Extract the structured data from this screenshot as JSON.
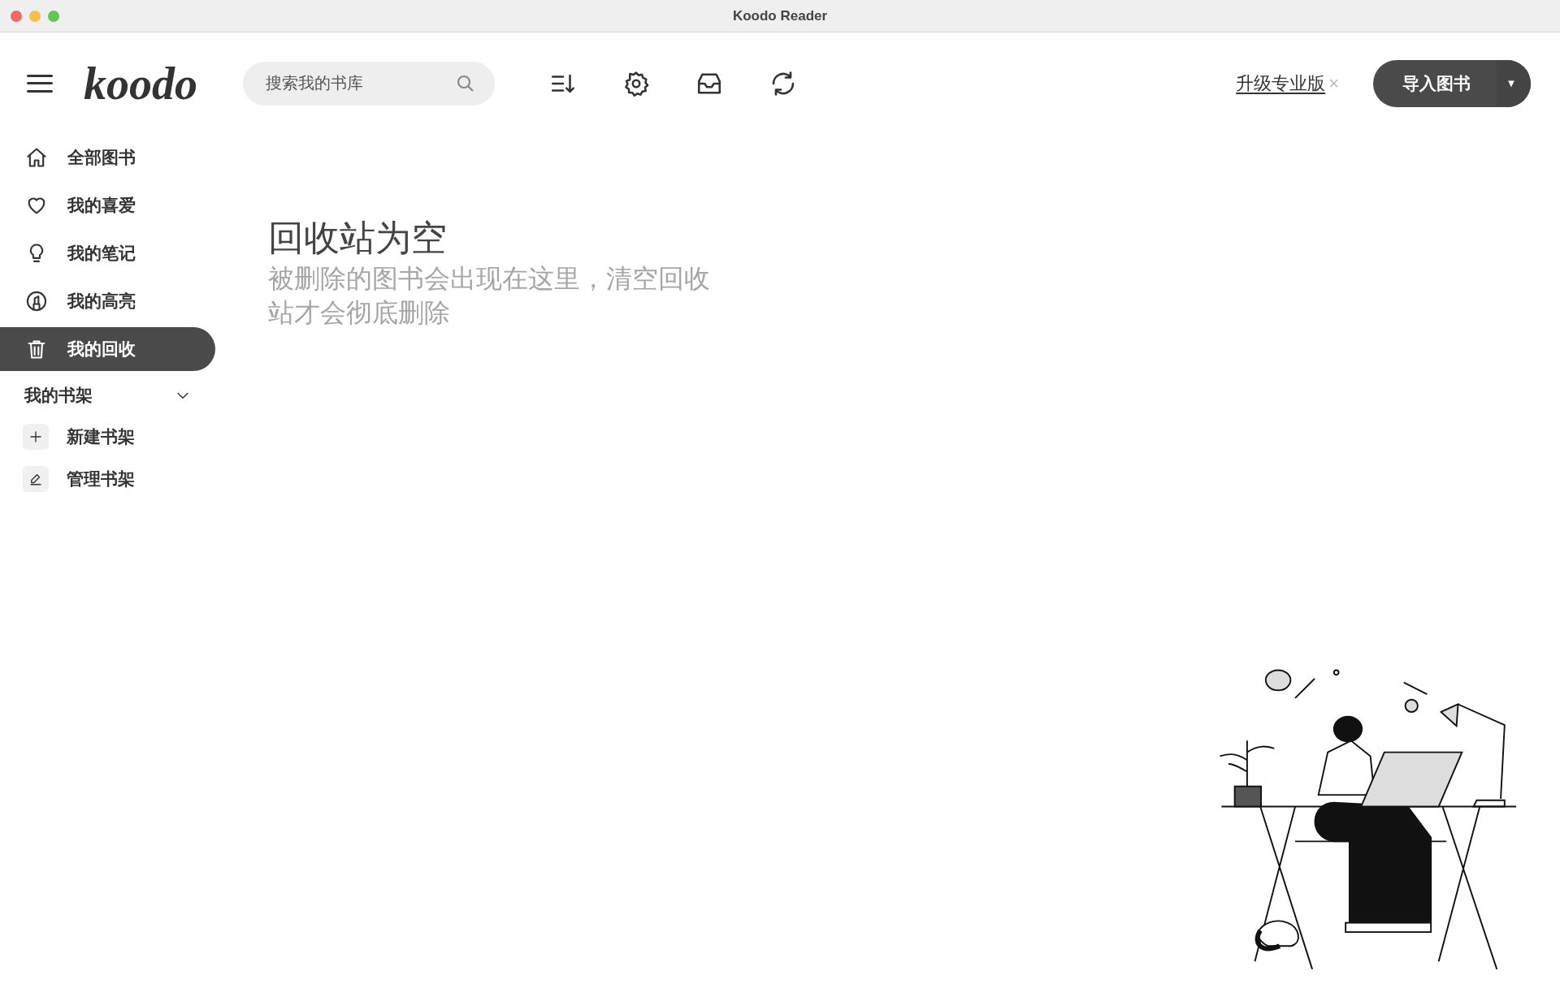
{
  "window": {
    "title": "Koodo Reader"
  },
  "header": {
    "logo": "koodo",
    "search": {
      "placeholder": "搜索我的书库"
    },
    "upgrade_link": "升级专业版",
    "close_mark": "×",
    "import_button": "导入图书",
    "dropdown_mark": "▼"
  },
  "sidebar": {
    "items": [
      {
        "label": "全部图书",
        "kind": "home",
        "selected": false
      },
      {
        "label": "我的喜爱",
        "kind": "heart",
        "selected": false
      },
      {
        "label": "我的笔记",
        "kind": "bulb",
        "selected": false
      },
      {
        "label": "我的高亮",
        "kind": "highlight",
        "selected": false
      },
      {
        "label": "我的回收",
        "kind": "trash",
        "selected": true
      }
    ],
    "shelf_section": {
      "title": "我的书架",
      "expanded": true,
      "actions": [
        {
          "label": "新建书架",
          "kind": "plus"
        },
        {
          "label": "管理书架",
          "kind": "pen"
        }
      ]
    }
  },
  "main": {
    "title": "回收站为空",
    "message": "被删除的图书会出现在这里，清空回收站才会彻底删除"
  }
}
